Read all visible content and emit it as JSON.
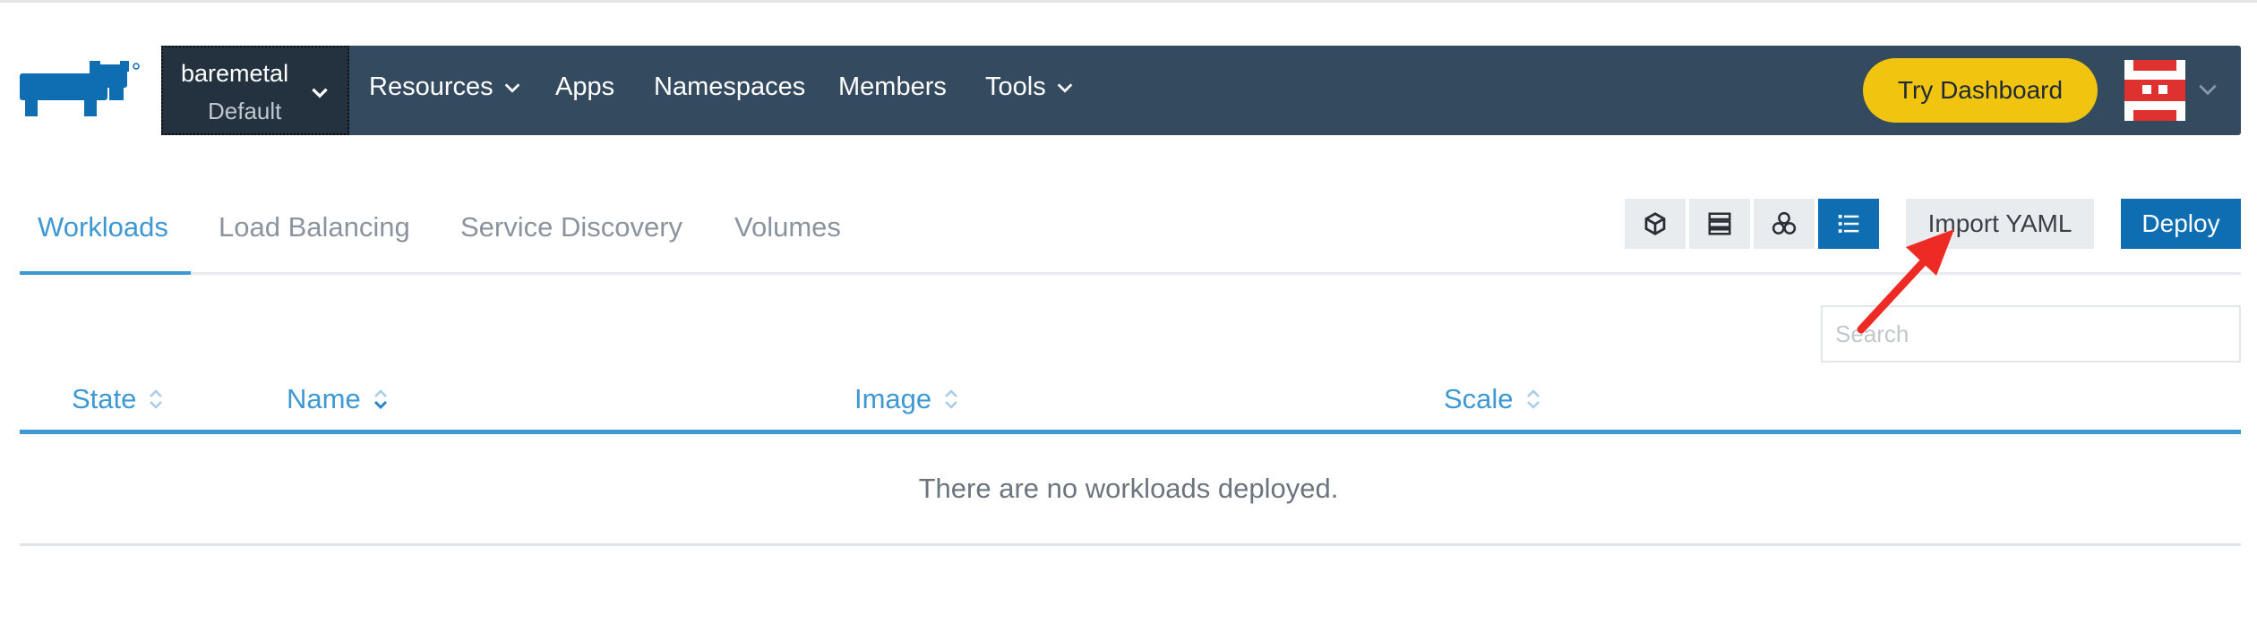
{
  "nav": {
    "cluster_name": "baremetal",
    "project_name": "Default",
    "items": [
      {
        "label": "Resources",
        "has_dropdown": true
      },
      {
        "label": "Apps",
        "has_dropdown": false
      },
      {
        "label": "Namespaces",
        "has_dropdown": false
      },
      {
        "label": "Members",
        "has_dropdown": false
      },
      {
        "label": "Tools",
        "has_dropdown": true
      }
    ],
    "try_dashboard": "Try Dashboard"
  },
  "tabs": [
    {
      "label": "Workloads",
      "active": true
    },
    {
      "label": "Load Balancing",
      "active": false
    },
    {
      "label": "Service Discovery",
      "active": false
    },
    {
      "label": "Volumes",
      "active": false
    }
  ],
  "toolbar": {
    "view_buttons": [
      "cube-icon",
      "server-list-icon",
      "namespace-cluster-icon",
      "list-icon"
    ],
    "active_view": "list-icon",
    "import_label": "Import YAML",
    "deploy_label": "Deploy"
  },
  "search": {
    "placeholder": "Search",
    "value": ""
  },
  "table": {
    "columns": [
      "State",
      "Name",
      "Image",
      "Scale"
    ],
    "empty_message": "There are no workloads deployed."
  },
  "colors": {
    "navbar": "#344a5f",
    "cluster_bg": "#24323f",
    "accent": "#3d98d3",
    "primary_button": "#0f6db2",
    "try_button": "#f1c40f",
    "avatar_red": "#e03131",
    "annotation_arrow": "#ee2a24"
  }
}
